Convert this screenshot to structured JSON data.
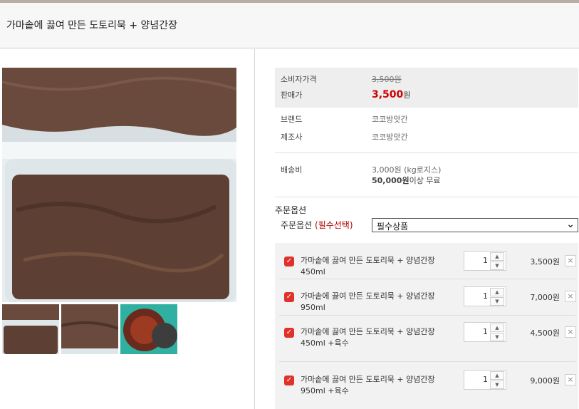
{
  "header": {
    "title": "가마솥에 끓여 만든 도토리묵 + 양념간장"
  },
  "gallery": {
    "main_image": "acorn-jelly-tray",
    "thumbnails": [
      "acorn-jelly-tray",
      "acorn-jelly-closeup",
      "seasoning-sauce-jar"
    ]
  },
  "info": {
    "consumer_price_label": "소비자가격",
    "consumer_price": "3,500원",
    "sale_price_label": "판매가",
    "sale_price_number": "3,500",
    "sale_price_unit": "원",
    "brand_label": "브랜드",
    "brand": "코코방앗간",
    "maker_label": "제조사",
    "maker": "코코방앗간",
    "shipping_label": "배송비",
    "shipping_fee": "3,000원 (kg로지스)",
    "free_threshold": "50,000원",
    "free_text": "이상 무료"
  },
  "options": {
    "section_title": "주문옵션",
    "label": "주문옵션",
    "required": "(필수선택)",
    "select_value": "필수상품",
    "items": [
      {
        "name": "가마솥에 끓여 만든 도토리묵 + 양념간장 450ml",
        "qty": "1",
        "price": "3,500원"
      },
      {
        "name": "가마솥에 끓여 만든 도토리묵 + 양념간장 950ml",
        "qty": "1",
        "price": "7,000원"
      },
      {
        "name": "가마솥에 끓여 만든 도토리묵 + 양념간장 450ml +육수",
        "qty": "1",
        "price": "4,500원"
      },
      {
        "name": "가마솥에 끓여 만든 도토리묵 + 양념간장 950ml +육수",
        "qty": "1",
        "price": "9,000원"
      }
    ]
  },
  "colors": {
    "accent_red": "#d00000",
    "checkbox_red": "#e0312b"
  }
}
